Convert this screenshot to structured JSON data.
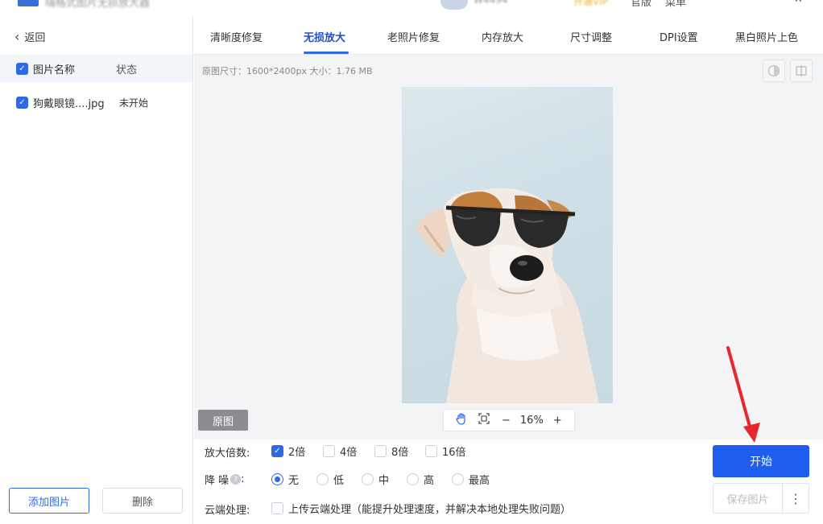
{
  "window": {
    "user_id": "W4494",
    "vip_label": "开通VIP",
    "controls": [
      "官版",
      "菜单",
      "—",
      "✕"
    ]
  },
  "sidebar": {
    "back_label": "返回",
    "header": {
      "name": "图片名称",
      "status": "状态"
    },
    "files": [
      {
        "name": "狗戴眼镜....jpg",
        "status": "未开始",
        "checked": true
      }
    ],
    "add_button": "添加图片",
    "delete_button": "删除"
  },
  "tabs": [
    "清晰度修复",
    "无损放大",
    "老照片修复",
    "内存放大",
    "尺寸调整",
    "DPI设置",
    "黑白照片上色"
  ],
  "active_tab": "无损放大",
  "preview": {
    "info": "原图尺寸：1600*2400px  大小：1.76 MB",
    "original_button": "原图",
    "zoom_level": "16%",
    "zoom_minus": "−",
    "zoom_plus": "+"
  },
  "options": {
    "scale": {
      "label": "放大倍数:",
      "choices": [
        "2倍",
        "4倍",
        "8倍",
        "16倍"
      ],
      "selected": "2倍"
    },
    "denoise": {
      "label": "降 噪",
      "colon": ":",
      "choices": [
        "无",
        "低",
        "中",
        "高",
        "最高"
      ],
      "selected": "无"
    },
    "cloud": {
      "label": "云端处理:",
      "text": "上传云端处理（能提升处理速度，并解决本地处理失败问题）",
      "checked": false
    }
  },
  "actions": {
    "start_button": "开始",
    "save_button": "保存图片",
    "more_button": "⋮"
  },
  "colors": {
    "accent": "#1f5cf0",
    "annotation_arrow": "#e8262d"
  }
}
